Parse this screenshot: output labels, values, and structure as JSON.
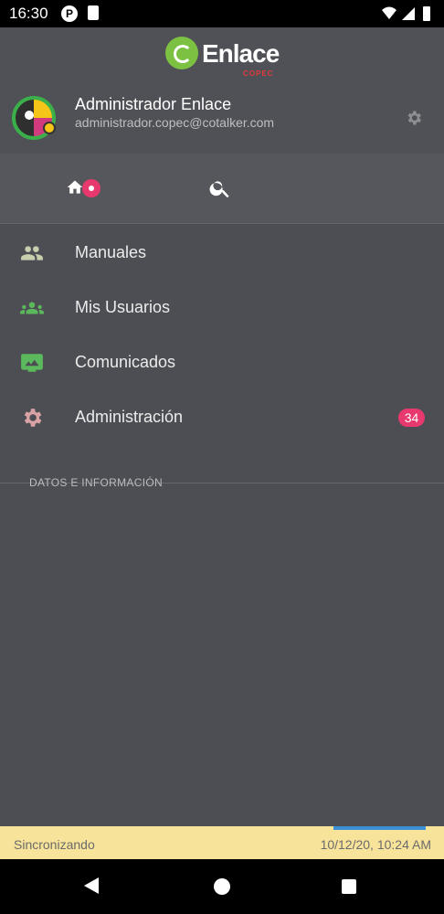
{
  "status_bar": {
    "time": "16:30",
    "p_icon": "P"
  },
  "brand": {
    "name": "Enlace",
    "sub": "COPEC",
    "logo_color": "#7dc143"
  },
  "user": {
    "name": "Administrador Enlace",
    "email": "administrador.copec@cotalker.com"
  },
  "tabs": [
    {
      "icon": "home-icon",
      "badge": true
    },
    {
      "icon": "search-icon"
    }
  ],
  "menu": {
    "items": [
      {
        "label": "Manuales",
        "icon": "group-icon",
        "icon_color": "#c8cfae"
      },
      {
        "label": "Mis Usuarios",
        "icon": "groups-icon",
        "icon_color": "#5cb85c"
      },
      {
        "label": "Comunicados",
        "icon": "image-icon",
        "icon_color": "#5cb85c"
      },
      {
        "label": "Administración",
        "icon": "gear-icon",
        "icon_color": "#d9a3a6",
        "badge": "34"
      }
    ]
  },
  "section": {
    "title": "DATOS E INFORMACIÓN"
  },
  "sync": {
    "label": "Sincronizando",
    "timestamp": "10/12/20, 10:24 AM"
  },
  "colors": {
    "accent": "#e8396e",
    "sync_bg": "#f7e39a",
    "progress": "#3a8fd6"
  }
}
